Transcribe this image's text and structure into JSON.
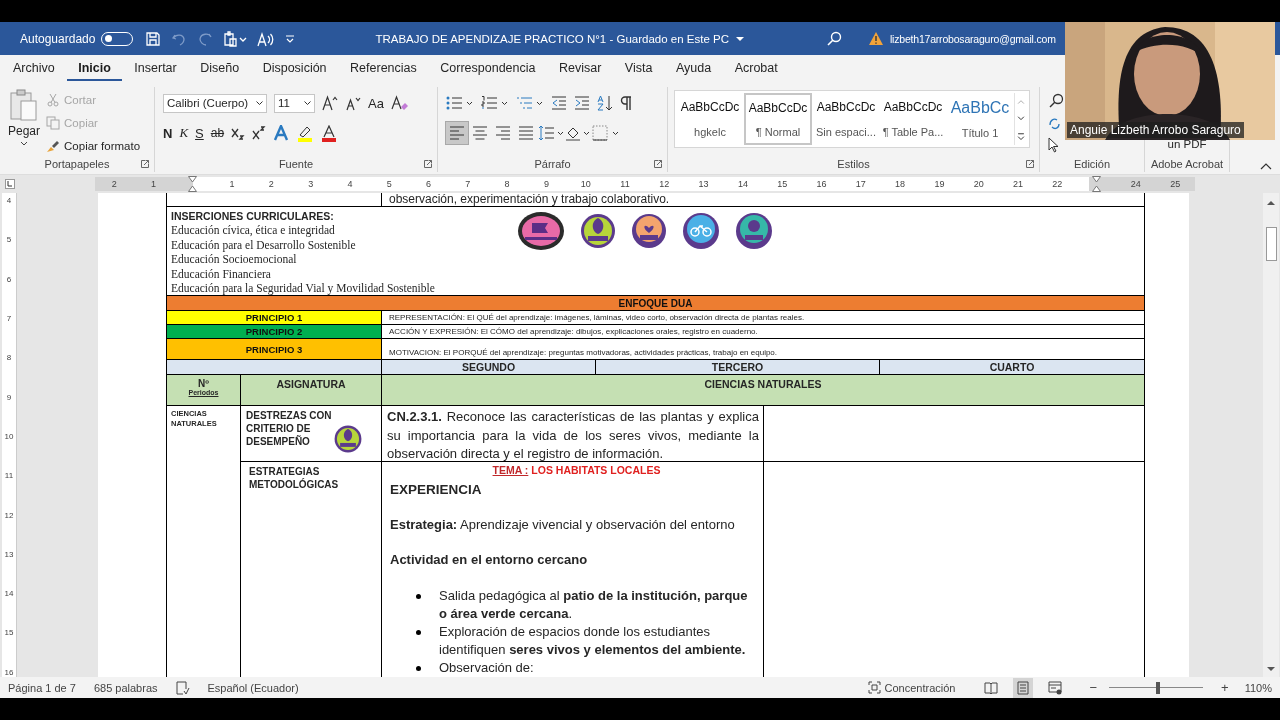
{
  "title_bar": {
    "autosave_label": "Autoguardado",
    "autosave_on": false,
    "quick_access": [
      {
        "kind": "save",
        "disabled": false
      },
      {
        "kind": "undo",
        "disabled": true
      },
      {
        "kind": "redo",
        "disabled": true
      },
      {
        "kind": "paste_options",
        "disabled": false
      },
      {
        "kind": "read_aloud",
        "disabled": false
      },
      {
        "kind": "customize",
        "disabled": false
      }
    ],
    "title": "TRABAJO DE APENDIZAJE PRACTICO N°1  -  Guardado en Este PC",
    "account": "lizbeth17arrobosaraguro@gmail.com"
  },
  "menu_tabs": [
    {
      "label": "Archivo",
      "selected": false
    },
    {
      "label": "Inicio",
      "selected": true
    },
    {
      "label": "Insertar",
      "selected": false
    },
    {
      "label": "Diseño",
      "selected": false
    },
    {
      "label": "Disposición",
      "selected": false
    },
    {
      "label": "Referencias",
      "selected": false
    },
    {
      "label": "Correspondencia",
      "selected": false
    },
    {
      "label": "Revisar",
      "selected": false
    },
    {
      "label": "Vista",
      "selected": false
    },
    {
      "label": "Ayuda",
      "selected": false
    },
    {
      "label": "Acrobat",
      "selected": false
    }
  ],
  "ribbon": {
    "clipboard": {
      "label": "Portapapeles",
      "paste": "Pegar",
      "actions": [
        {
          "kind": "cut",
          "label": "Cortar",
          "disabled": true
        },
        {
          "kind": "copy",
          "label": "Copiar",
          "disabled": true
        },
        {
          "kind": "format_painter",
          "label": "Copiar formato",
          "disabled": false
        }
      ]
    },
    "font": {
      "label": "Fuente",
      "font_name": "Calibri (Cuerpo)",
      "font_size": "11",
      "case_button": "Aa",
      "bold": "N",
      "italic": "K",
      "underline": "S",
      "strike": "ab"
    },
    "paragraph": {
      "label": "Párrafo",
      "alignments": [
        {
          "kind": "left",
          "selected": true
        },
        {
          "kind": "center",
          "selected": false
        },
        {
          "kind": "right",
          "selected": false
        },
        {
          "kind": "justify",
          "selected": false
        }
      ]
    },
    "styles": {
      "label": "Estilos",
      "items": [
        {
          "kind": "plain",
          "preview": "AaBbCcDc",
          "name": "hgkelc",
          "selected": false
        },
        {
          "kind": "plain",
          "preview": "AaBbCcDc",
          "name": "¶ Normal",
          "selected": true
        },
        {
          "kind": "plain",
          "preview": "AaBbCcDc",
          "name": "Sin espaci...",
          "selected": false
        },
        {
          "kind": "plain",
          "preview": "AaBbCcDc",
          "name": "¶ Table Pa...",
          "selected": false
        },
        {
          "kind": "heading",
          "preview": "AaBbCc",
          "name": "Título 1",
          "selected": false
        }
      ]
    },
    "editing": {
      "label": "Edición"
    },
    "acrobat": {
      "button": "un PDF",
      "label": "Adobe Acrobat"
    }
  },
  "ruler": [
    {
      "kind": "number",
      "label": "2"
    },
    {
      "kind": "number",
      "label": "1"
    },
    {
      "kind": "marker"
    },
    {
      "kind": "number",
      "label": "1"
    },
    {
      "kind": "number",
      "label": "2"
    },
    {
      "kind": "number",
      "label": "3"
    },
    {
      "kind": "number",
      "label": "4"
    },
    {
      "kind": "number",
      "label": "5"
    },
    {
      "kind": "number",
      "label": "6"
    },
    {
      "kind": "number",
      "label": "7"
    },
    {
      "kind": "number",
      "label": "8"
    },
    {
      "kind": "number",
      "label": "9"
    },
    {
      "kind": "number",
      "label": "10"
    },
    {
      "kind": "number",
      "label": "11"
    },
    {
      "kind": "number",
      "label": "12"
    },
    {
      "kind": "number",
      "label": "13"
    },
    {
      "kind": "number",
      "label": "14"
    },
    {
      "kind": "number",
      "label": "15"
    },
    {
      "kind": "number",
      "label": "16"
    },
    {
      "kind": "number",
      "label": "17"
    },
    {
      "kind": "number",
      "label": "18"
    },
    {
      "kind": "number",
      "label": "19"
    },
    {
      "kind": "number",
      "label": "20"
    },
    {
      "kind": "number",
      "label": "21"
    },
    {
      "kind": "number",
      "label": "22"
    },
    {
      "kind": "marker"
    },
    {
      "kind": "number",
      "label": "24"
    },
    {
      "kind": "number",
      "label": "25"
    }
  ],
  "vertical_ruler": [
    "4",
    "5",
    "6",
    "7",
    "8",
    "9",
    "10",
    "11",
    "12",
    "13",
    "14",
    "15",
    "16"
  ],
  "document": {
    "top_line": "observación, experimentación y trabajo colaborativo.",
    "insertions": {
      "title": "INSERCIONES CURRICULARES:",
      "items": [
        "Educación cívica, ética e integridad",
        "Educación para el Desarrollo Sostenible",
        "Educación Socioemocional",
        "Educación Financiera",
        "Educación para la Seguridad Vial y Movilidad Sostenible"
      ]
    },
    "approach": {
      "title": "ENFOQUE DUA",
      "principles": [
        {
          "label": "PRINCIPIO 1",
          "color": "#ffff00",
          "text": "REPRESENTACIÓN: El QUÉ del aprendizaje: imágenes, láminas, video corto, observación directa de plantas reales."
        },
        {
          "label": "PRINCIPIO 2",
          "color": "#00b050",
          "text": "ACCIÓN Y EXPRESIÓN: El CÓMO del aprendizaje: dibujos, explicaciones orales, registro en cuaderno."
        },
        {
          "label": "PRINCIPIO 3",
          "color": "#ffc000",
          "text": "MOTIVACION: El PORQUÉ del aprendizaje: preguntas motivadoras, actividades prácticas, trabajo en equipo."
        }
      ]
    },
    "grades": [
      "SEGUNDO",
      "TERCERO",
      "CUARTO"
    ],
    "header": {
      "number": "Nº",
      "number_note": "Periodos",
      "subject": "ASIGNATURA",
      "area": "CIENCIAS NATURALES"
    },
    "subject_cell": "CIENCIAS NATURALES",
    "skills": {
      "label": "DESTREZAS CON CRITERIO DE DESEMPEÑO",
      "text": "**CN.2.3.1.** Reconoce las características de las plantas y explica su importancia para la vida de los seres vivos, mediante la observación directa y el registro de información."
    },
    "strategies": {
      "label": "ESTRATEGIAS METODOLÓGICAS",
      "topic_label": "TEMA :",
      "topic": "LOS HABITATS LOCALES",
      "content": [
        {
          "kind": "heading",
          "text": "EXPERIENCIA"
        },
        {
          "kind": "paragraph",
          "text": "**Estrategia:** Aprendizaje vivencial y observación del entorno"
        },
        {
          "kind": "subheading",
          "text": "Actividad en el entorno cercano"
        },
        {
          "kind": "bullets",
          "items": [
            "Salida pedagógica al **patio de la institución, parque o área verde cercana**.",
            "Exploración de espacios donde los estudiantes identifiquen **seres vivos y elementos del ambiente.**",
            "Observación de:"
          ]
        }
      ]
    }
  },
  "status_bar": {
    "page": "Página 1 de 7",
    "words": "685 palabras",
    "language": "Español (Ecuador)",
    "focus": "Concentración",
    "views": [
      {
        "kind": "read",
        "selected": false
      },
      {
        "kind": "print",
        "selected": true
      },
      {
        "kind": "web",
        "selected": false
      }
    ],
    "zoom_minus": "−",
    "zoom_plus": "+",
    "zoom_slider": {
      "level": 0.52
    },
    "zoom": "110%"
  },
  "video_call": {
    "participant": "Anguie Lizbeth Arrobo Saraguro"
  }
}
